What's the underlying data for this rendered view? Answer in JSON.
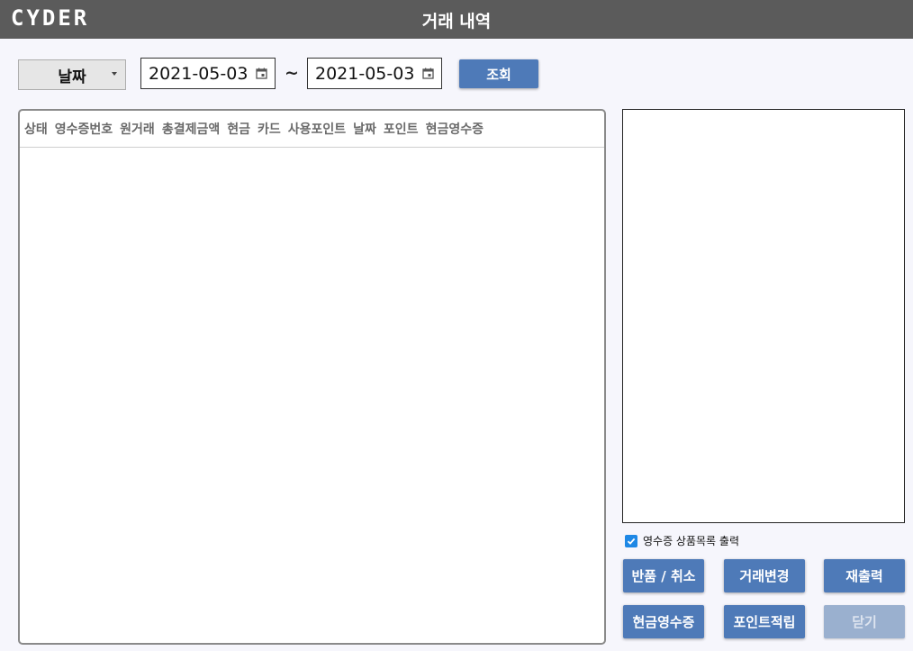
{
  "header": {
    "logo": "CYDER",
    "title": "거래 내역"
  },
  "filter": {
    "type_selected": "날짜",
    "date_from": "2021-05-03",
    "separator": "~",
    "date_to": "2021-05-03",
    "search_label": "조회"
  },
  "table": {
    "columns": [
      "상태",
      "영수증번호",
      "원거래",
      "총결제금액",
      "현금",
      "카드",
      "사용포인트",
      "날짜",
      "포인트",
      "현금영수증"
    ],
    "rows": []
  },
  "options": {
    "print_items_label": "영수증 상품목록 출력",
    "print_items_checked": true
  },
  "actions": {
    "refund": "반품 / 취소",
    "change": "거래변경",
    "reprint": "재출력",
    "cash_receipt": "현금영수증",
    "points": "포인트적립",
    "close": "닫기"
  },
  "colors": {
    "titlebar": "#5b5b5b",
    "button": "#4e7ab8",
    "button_disabled": "#9ab0cf",
    "checkbox": "#1e88e5"
  }
}
